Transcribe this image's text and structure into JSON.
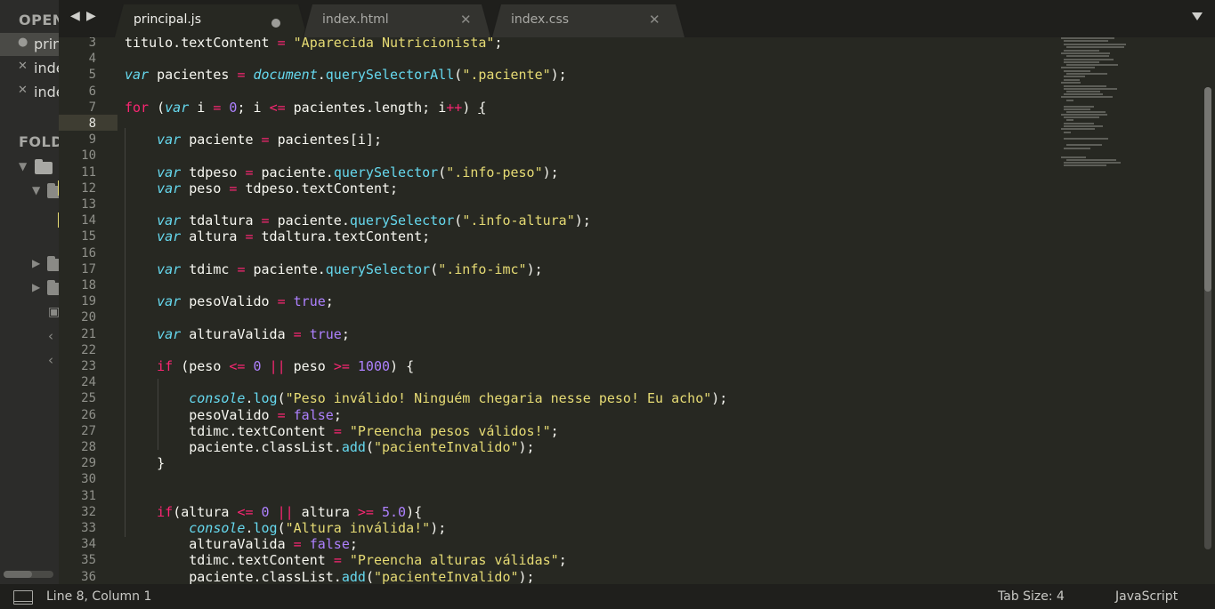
{
  "sidebar": {
    "open_files_header": "OPEN FILES",
    "folders_header": "FOLDERS",
    "open_files": [
      {
        "mark": "●",
        "name": "principal.js"
      },
      {
        "mark": "✕",
        "name": "index.html"
      },
      {
        "mark": "✕",
        "name": "index.css"
      }
    ]
  },
  "tabs": [
    {
      "label": "principal.js",
      "active": true,
      "modified": true
    },
    {
      "label": "index.html",
      "active": false,
      "modified": false,
      "close": "✕"
    },
    {
      "label": "index.css",
      "active": false,
      "modified": false,
      "close": "✕"
    }
  ],
  "nav": {
    "back": "◀",
    "forward": "▶"
  },
  "code": {
    "current_line": 8,
    "lines": [
      {
        "n": 3,
        "html": "titulo.textContent <span class=o>=</span> <span class=s>\"Aparecida Nutricionista\"</span>;"
      },
      {
        "n": 4,
        "html": ""
      },
      {
        "n": 5,
        "html": "<span class=t>var</span> pacientes <span class=o>=</span> <span class=t>document</span>.<span class=f>querySelectorAll</span>(<span class=s>\".paciente\"</span>);"
      },
      {
        "n": 6,
        "html": ""
      },
      {
        "n": 7,
        "html": "<span class=k>for</span> (<span class=t>var</span> i <span class=o>=</span> <span class=n>0</span>; i <span class=o>&lt;=</span> pacientes.length; i<span class=o>++</span>) <span class=u>{</span>"
      },
      {
        "n": 8,
        "html": ""
      },
      {
        "n": 9,
        "html": "    <span class=t>var</span> paciente <span class=o>=</span> pacientes[i];"
      },
      {
        "n": 10,
        "html": ""
      },
      {
        "n": 11,
        "html": "    <span class=t>var</span> tdpeso <span class=o>=</span> paciente.<span class=f>querySelector</span>(<span class=s>\".info-peso\"</span>);"
      },
      {
        "n": 12,
        "html": "    <span class=t>var</span> peso <span class=o>=</span> tdpeso.textContent;"
      },
      {
        "n": 13,
        "html": ""
      },
      {
        "n": 14,
        "html": "    <span class=t>var</span> tdaltura <span class=o>=</span> paciente.<span class=f>querySelector</span>(<span class=s>\".info-altura\"</span>);"
      },
      {
        "n": 15,
        "html": "    <span class=t>var</span> altura <span class=o>=</span> tdaltura.textContent;"
      },
      {
        "n": 16,
        "html": ""
      },
      {
        "n": 17,
        "html": "    <span class=t>var</span> tdimc <span class=o>=</span> paciente.<span class=f>querySelector</span>(<span class=s>\".info-imc\"</span>);"
      },
      {
        "n": 18,
        "html": ""
      },
      {
        "n": 19,
        "html": "    <span class=t>var</span> pesoValido <span class=o>=</span> <span class=n>true</span>;"
      },
      {
        "n": 20,
        "html": ""
      },
      {
        "n": 21,
        "html": "    <span class=t>var</span> alturaValida <span class=o>=</span> <span class=n>true</span>;"
      },
      {
        "n": 22,
        "html": ""
      },
      {
        "n": 23,
        "html": "    <span class=k>if</span> (peso <span class=o>&lt;=</span> <span class=n>0</span> <span class=o>||</span> peso <span class=o>&gt;=</span> <span class=n>1000</span>) {"
      },
      {
        "n": 24,
        "html": ""
      },
      {
        "n": 25,
        "html": "        <span class=t>console</span>.<span class=f>log</span>(<span class=s>\"Peso inválido! Ninguém chegaria nesse peso! Eu acho\"</span>);"
      },
      {
        "n": 26,
        "html": "        pesoValido <span class=o>=</span> <span class=n>false</span>;"
      },
      {
        "n": 27,
        "html": "        tdimc.textContent <span class=o>=</span> <span class=s>\"Preencha pesos válidos!\"</span>;"
      },
      {
        "n": 28,
        "html": "        paciente.classList.<span class=f>add</span>(<span class=s>\"pacienteInvalido\"</span>);"
      },
      {
        "n": 29,
        "html": "    }"
      },
      {
        "n": 30,
        "html": ""
      },
      {
        "n": 31,
        "html": ""
      },
      {
        "n": 32,
        "html": "    <span class=k>if</span>(altura <span class=o>&lt;=</span> <span class=n>0</span> <span class=o>||</span> altura <span class=o>&gt;=</span> <span class=n>5.0</span>){"
      },
      {
        "n": 33,
        "html": "        <span class=t>console</span>.<span class=f>log</span>(<span class=s>\"Altura inválida!\"</span>);"
      },
      {
        "n": 34,
        "html": "        alturaValida <span class=o>=</span> <span class=n>false</span>;"
      },
      {
        "n": 35,
        "html": "        tdimc.textContent <span class=o>=</span> <span class=s>\"Preencha alturas válidas\"</span>;"
      },
      {
        "n": 36,
        "html": "        paciente.classList.<span class=f>add</span>(<span class=s>\"pacienteInvalido\"</span>);"
      }
    ]
  },
  "status": {
    "position": "Line 8, Column 1",
    "tab_size": "Tab Size: 4",
    "syntax": "JavaScript"
  },
  "colors": {
    "background": "#272822",
    "keyword": "#f92672",
    "string": "#e6db74",
    "number": "#ae81ff",
    "function": "#66d9ef"
  }
}
